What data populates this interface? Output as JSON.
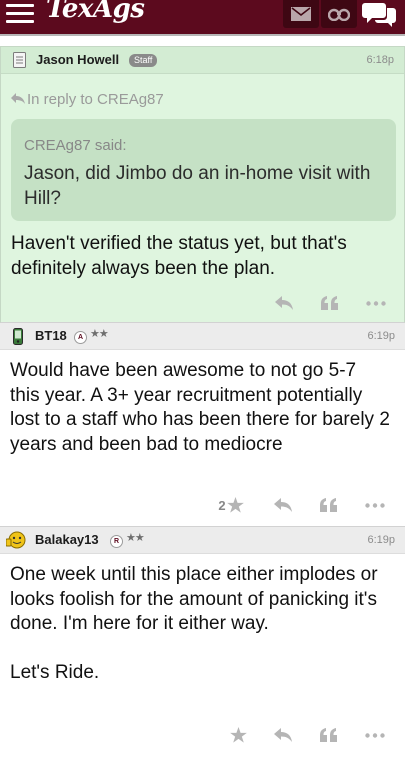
{
  "header": {
    "logo": "TexAgs",
    "icons": [
      "menu-icon",
      "mail-icon",
      "binoculars-icon",
      "chat-icon"
    ]
  },
  "posts": [
    {
      "username": "Jason Howell",
      "badge": "Staff",
      "time": "6:18p",
      "reply_to": "In reply to CREAg87",
      "quote_header": "CREAg87 said:",
      "quote_text": "Jason, did Jimbo do an in-home visit with Hill?",
      "body": "Haven't verified the status yet, but that's definitely always been the plan."
    },
    {
      "username": "BT18",
      "rank_badge": "A",
      "stars": "★★",
      "time": "6:19p",
      "body": "Would have been awesome to not go 5-7 this year. A 3+ year recruitment potentially lost to a staff who has been there for barely 2 years and been bad to mediocre",
      "likes": "2"
    },
    {
      "username": "Balakay13",
      "rank_badge": "R",
      "stars": "★★",
      "time": "6:19p",
      "body": "One week until this place either implodes or looks foolish for the amount of panicking it's done. I'm here for it either way.\n\nLet's Ride."
    }
  ]
}
